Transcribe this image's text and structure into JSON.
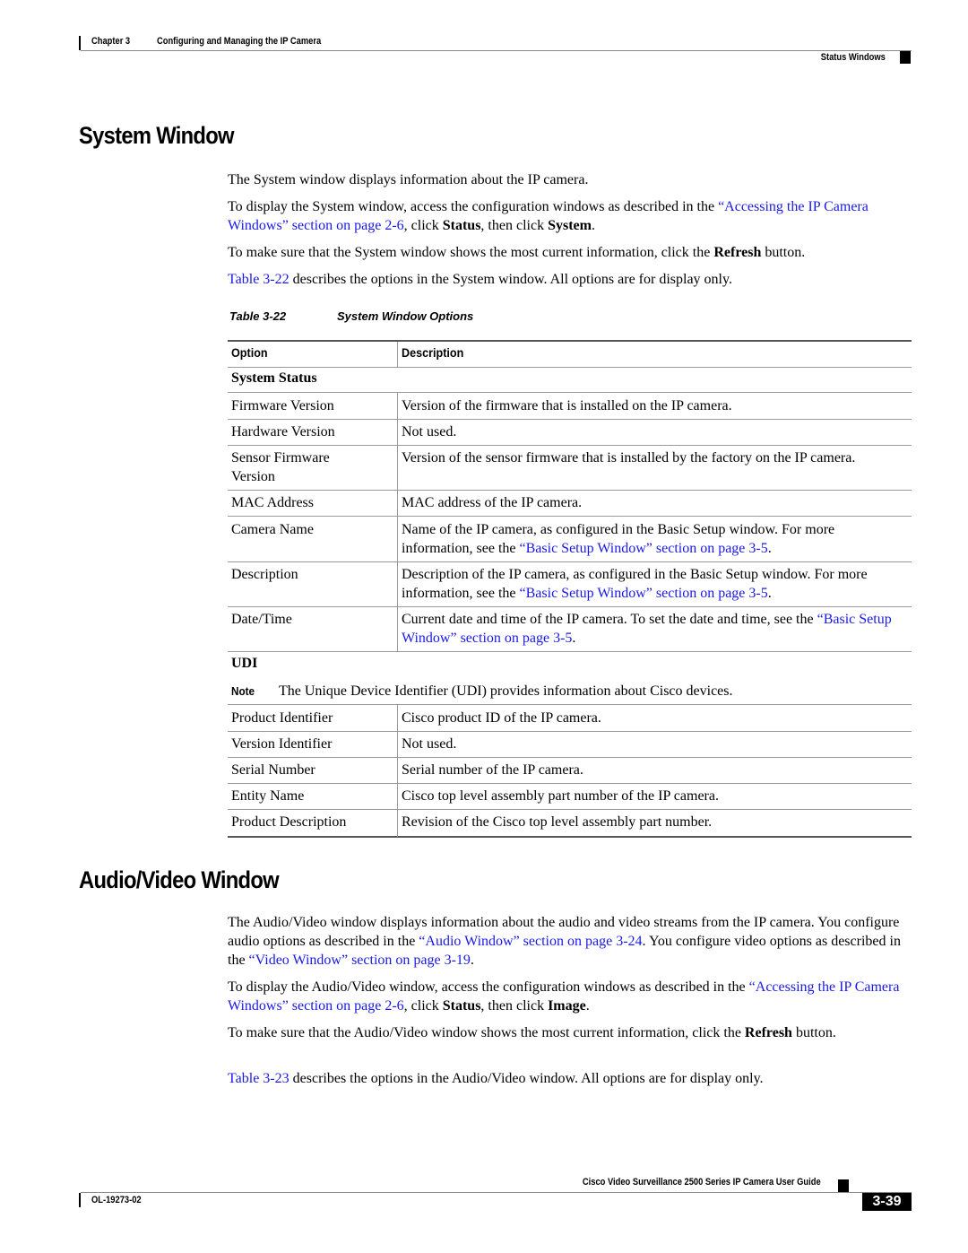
{
  "header": {
    "chapter": "Chapter 3",
    "chapter_title": "Configuring and Managing the IP Camera",
    "section": "Status Windows"
  },
  "system_window": {
    "title": "System Window",
    "para1": "The System window displays information about the IP camera.",
    "para2": {
      "pre": "To display the System window, access the configuration windows as described in the ",
      "link": "“Accessing the IP Camera Windows” section on page 2-6",
      "mid1": ", click ",
      "bold1": "Status",
      "mid2": ", then click ",
      "bold2": "System",
      "post": "."
    },
    "para3": {
      "pre": "To make sure that the System window shows the most current information, click the ",
      "bold": "Refresh",
      "post": " button."
    },
    "para4": {
      "link": "Table 3-22",
      "post": " describes the options in the System window. All options are for display only."
    }
  },
  "table": {
    "caption_label": "Table 3-22",
    "caption_title": "System Window Options",
    "col_option": "Option",
    "col_description": "Description",
    "section1": "System Status",
    "rows1": [
      {
        "option": "Firmware Version",
        "description": "Version of the firmware that is installed on the IP camera."
      },
      {
        "option": "Hardware Version",
        "description": "Not used."
      },
      {
        "option": "Sensor Firmware Version",
        "description": "Version of the sensor firmware that is installed by the factory on the IP camera."
      },
      {
        "option": "MAC Address",
        "description": "MAC address of the IP camera."
      },
      {
        "option": "Camera Name",
        "description": "Name of the IP camera, as configured in the Basic Setup window. For more information, see the ",
        "link": "“Basic Setup Window” section on page 3-5",
        "post": "."
      },
      {
        "option": "Description",
        "description": "Description of the IP camera, as configured in the Basic Setup window. For more information, see the ",
        "link": "“Basic Setup Window” section on page 3-5",
        "post": "."
      },
      {
        "option": "Date/Time",
        "description": "Current date and time of the IP camera. To set the date and time, see the ",
        "link": "“Basic Setup Window” section on page 3-5",
        "post": "."
      }
    ],
    "section2": "UDI",
    "note_label": "Note",
    "note_text": "The Unique Device Identifier (UDI) provides information about Cisco devices.",
    "rows2": [
      {
        "option": "Product Identifier",
        "description": "Cisco product ID of the IP camera."
      },
      {
        "option": "Version Identifier",
        "description": "Not used."
      },
      {
        "option": "Serial Number",
        "description": "Serial number of the IP camera."
      },
      {
        "option": "Entity Name",
        "description": "Cisco top level assembly part number of the IP camera."
      },
      {
        "option": "Product Description",
        "description": "Revision of the Cisco top level assembly part number."
      }
    ]
  },
  "av_window": {
    "title": "Audio/Video Window",
    "para1": {
      "pre": "The Audio/Video window displays information about the audio and video streams from the IP camera. You configure audio options as described in the ",
      "link1": "“Audio Window” section on page 3-24",
      "mid": ". You configure video options as described in the ",
      "link2": "“Video Window” section on page 3-19",
      "post": "."
    },
    "para2": {
      "pre": "To display the Audio/Video window, access the configuration windows as described in the ",
      "link": "“Accessing the IP Camera Windows” section on page 2-6",
      "mid1": ", click ",
      "bold1": "Status",
      "mid2": ", then click ",
      "bold2": "Image",
      "post": "."
    },
    "para3": {
      "pre": "To make sure that the Audio/Video window shows the most current information, click the ",
      "bold": "Refresh",
      "post": " button."
    },
    "para4": {
      "link": "Table 3-23",
      "post": " describes the options in the Audio/Video window. All options are for display only."
    }
  },
  "footer": {
    "guide_title": "Cisco Video Surveillance 2500 Series IP Camera User Guide",
    "doc_number": "OL-19273-02",
    "page_number": "3-39"
  },
  "colors": {
    "link": "#1a1ae6",
    "rule": "#9a9a9a",
    "page_badge": "#000000"
  }
}
